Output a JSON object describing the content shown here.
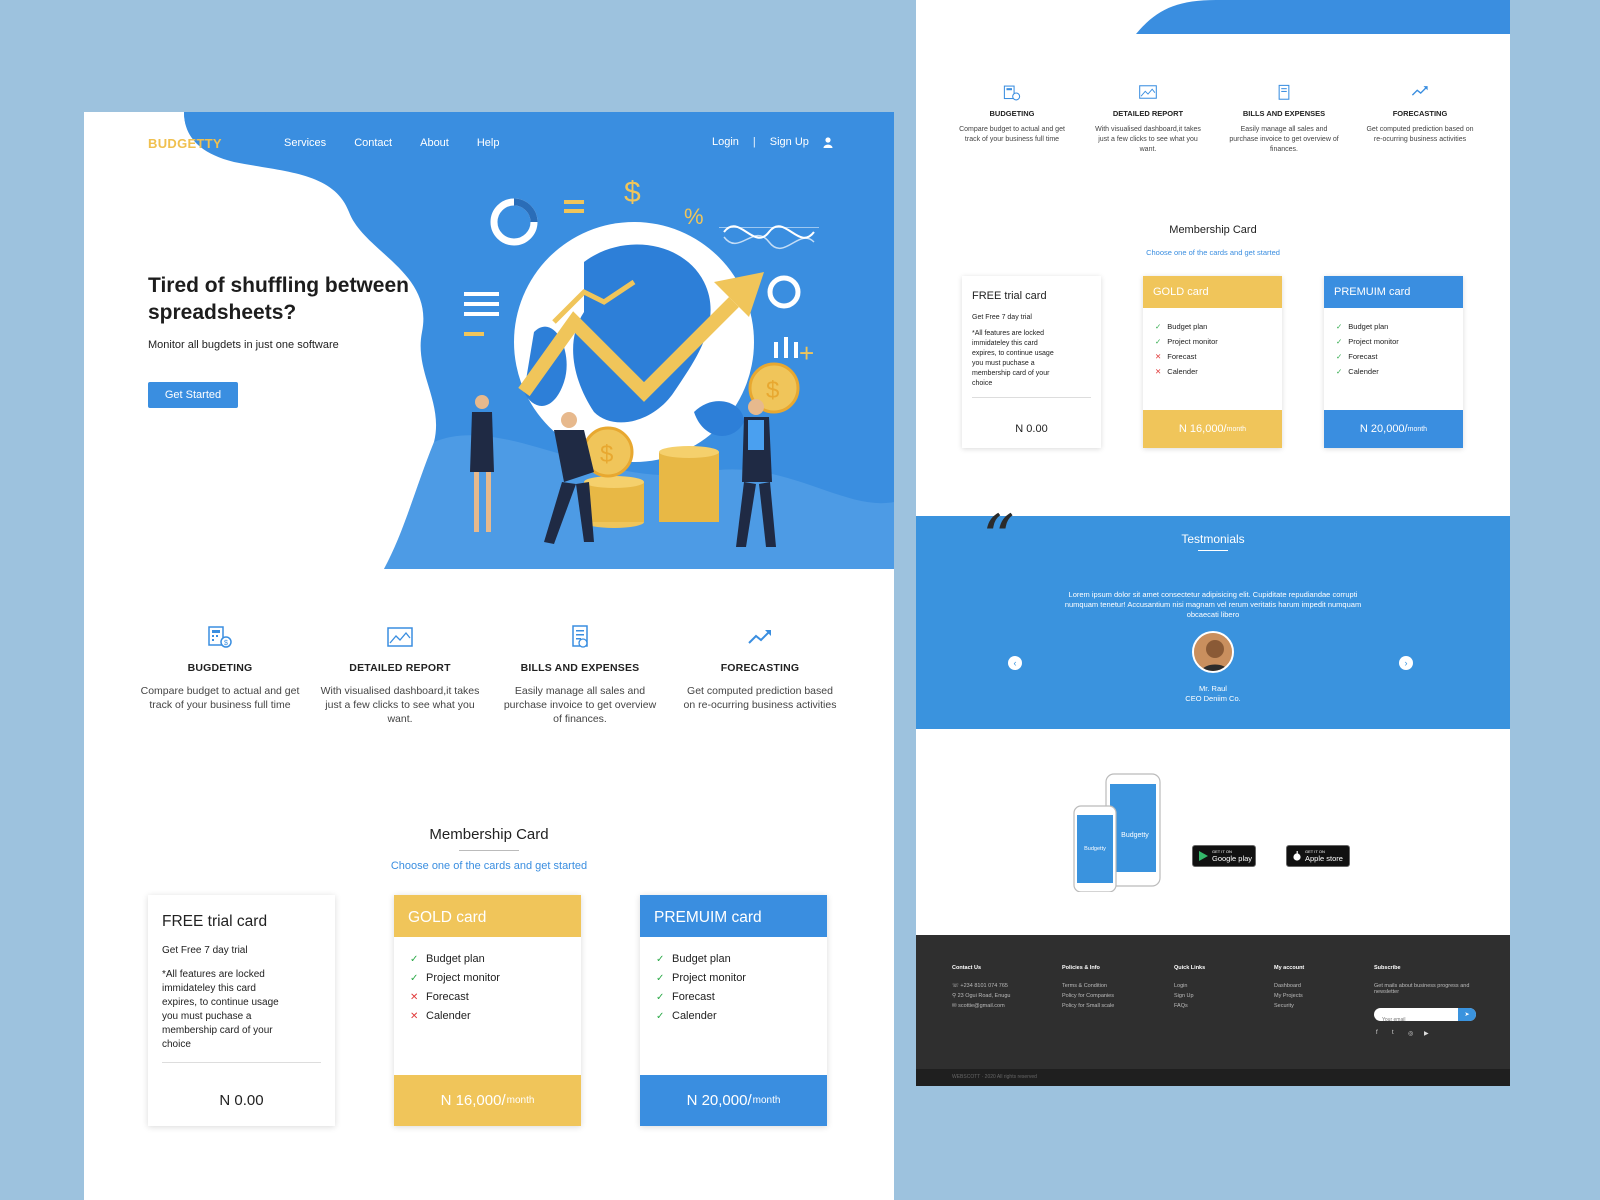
{
  "colors": {
    "primary": "#3a8ee0",
    "gold": "#f0c55a",
    "logo": "#f0c04f",
    "background": "#9dc2de",
    "footer": "#2f2f2f",
    "ok": "#2eaa4a",
    "no": "#e03a3a"
  },
  "left": {
    "logo": "BUDGETTY",
    "nav": [
      "Services",
      "Contact",
      "About",
      "Help"
    ],
    "auth": {
      "login": "Login",
      "separator": "|",
      "signup": "Sign Up"
    },
    "hero": {
      "title": "Tired of shuffling between spreadsheets?",
      "subtitle": "Monitor all bugdets in just one software",
      "cta": "Get Started"
    },
    "features": [
      {
        "icon": "budget-calculator-icon",
        "title": "BUGDETING",
        "desc": "Compare budget to actual and get track of your business full time"
      },
      {
        "icon": "chart-image-icon",
        "title": "DETAILED REPORT",
        "desc": "With visualised dashboard,it takes just a few clicks to see what you want."
      },
      {
        "icon": "invoice-icon",
        "title": "BILLS AND EXPENSES",
        "desc": "Easily manage all sales and purchase invoice to get overview of finances."
      },
      {
        "icon": "trend-up-icon",
        "title": "FORECASTING",
        "desc": "Get computed prediction based on re-ocurring business activities"
      }
    ],
    "membership": {
      "title": "Membership Card",
      "subtitle": "Choose one of the cards and get started",
      "free": {
        "title": "FREE trial card",
        "trial": "Get Free 7 day trial",
        "note": "*All features are locked immidateley this card expires, to continue usage you must puchase a membership card of your choice",
        "price": "N 0.00"
      },
      "gold": {
        "title": "GOLD card",
        "features": [
          {
            "label": "Budget plan",
            "mark": "✓",
            "ok": true
          },
          {
            "label": "Project monitor",
            "mark": "✓",
            "ok": true
          },
          {
            "label": "Forecast",
            "mark": "✕",
            "ok": false
          },
          {
            "label": "Calender",
            "mark": "✕",
            "ok": false
          }
        ],
        "price": "N 16,000/",
        "period": "month"
      },
      "premium": {
        "title": "PREMUIM card",
        "features": [
          {
            "label": "Budget plan",
            "mark": "✓",
            "ok": true
          },
          {
            "label": "Project monitor",
            "mark": "✓",
            "ok": true
          },
          {
            "label": "Forecast",
            "mark": "✓",
            "ok": true
          },
          {
            "label": "Calender",
            "mark": "✓",
            "ok": true
          }
        ],
        "price": "N 20,000/",
        "period": "month"
      }
    }
  },
  "right": {
    "features": [
      {
        "title": "BUDGETING",
        "desc": "Compare budget to actual and get track of your business full time"
      },
      {
        "title": "DETAILED REPORT",
        "desc": "With visualised dashboard,it takes just a few clicks to see what you want."
      },
      {
        "title": "BILLS AND EXPENSES",
        "desc": "Easily manage all sales and purchase invoice to get overview of finances."
      },
      {
        "title": "FORECASTING",
        "desc": "Get computed prediction based on re-ocurring business activities"
      }
    ],
    "membership": {
      "title": "Membership Card",
      "subtitle": "Choose one of the cards and get started"
    },
    "testimonials": {
      "title": "Testmonials",
      "quote_mark": "“",
      "text": "Lorem ipsum dolor sit amet consectetur adipisicing elit. Cupiditate repudiandae corrupti numquam tenetur! Accusantium nisi magnam vel rerum veritatis harum impedit numquam obcaecati libero",
      "name": "Mr. Raul",
      "role": "CEO Deniim Co."
    },
    "app": {
      "phone_label": "Budgetty",
      "google": {
        "small": "GET IT ON",
        "big": "Google play"
      },
      "apple": {
        "small": "GET IT ON",
        "big": "Apple store"
      }
    },
    "footer": {
      "contact": {
        "heading": "Contact Us",
        "phone": "+234 8101 074 765",
        "address": "23 Ogui Road, Enugu",
        "email": "scottie@gmail.com"
      },
      "policies": {
        "heading": "Policies & Info",
        "links": [
          "Terms & Condition",
          "Policy for Companies",
          "Policy for Small scale"
        ]
      },
      "quick": {
        "heading": "Quick Links",
        "links": [
          "Login",
          "Sign Up",
          "FAQs"
        ]
      },
      "account": {
        "heading": "My account",
        "links": [
          "Dashboard",
          "My Projects",
          "Security"
        ]
      },
      "subscribe": {
        "heading": "Subscribe",
        "text": "Get mails about business progress and newsletter",
        "placeholder": "Your email"
      },
      "copyright": "WEBSCOTT   ·   2020 All rights reserved"
    }
  }
}
